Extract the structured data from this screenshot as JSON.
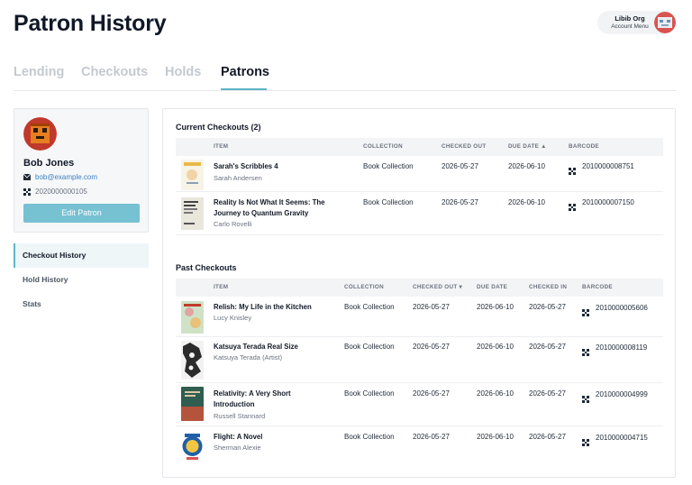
{
  "page_title": "Patron History",
  "account": {
    "org": "Libib Org",
    "menu_label": "Account Menu"
  },
  "tabs": [
    {
      "label": "Lending",
      "active": false
    },
    {
      "label": "Checkouts",
      "active": false
    },
    {
      "label": "Holds",
      "active": false
    },
    {
      "label": "Patrons",
      "active": true
    }
  ],
  "patron": {
    "name": "Bob Jones",
    "email": "bob@example.com",
    "card_number": "2020000000105",
    "edit_label": "Edit Patron"
  },
  "side_nav": [
    {
      "label": "Checkout History",
      "active": true
    },
    {
      "label": "Hold History",
      "active": false
    },
    {
      "label": "Stats",
      "active": false
    }
  ],
  "current_checkouts": {
    "title": "Current Checkouts (2)",
    "columns": [
      "ITEM",
      "COLLECTION",
      "CHECKED OUT",
      "DUE DATE ▲",
      "BARCODE"
    ],
    "rows": [
      {
        "title": "Sarah's Scribbles 4",
        "author": "Sarah Andersen",
        "collection": "Book Collection",
        "checked_out": "2026-05-27",
        "due_date": "2026-06-10",
        "barcode": "2010000008751",
        "cover": "scribbles-cover"
      },
      {
        "title": "Reality Is Not What It Seems: The Journey to Quantum Gravity",
        "author": "Carlo Rovelli",
        "collection": "Book Collection",
        "checked_out": "2026-05-27",
        "due_date": "2026-06-10",
        "barcode": "2010000007150",
        "cover": "reality-cover"
      }
    ]
  },
  "past_checkouts": {
    "title": "Past Checkouts",
    "columns": [
      "ITEM",
      "COLLECTION",
      "CHECKED OUT ▾",
      "DUE DATE",
      "CHECKED IN",
      "BARCODE"
    ],
    "rows": [
      {
        "title": "Relish: My Life in the Kitchen",
        "author": "Lucy Knisley",
        "collection": "Book Collection",
        "checked_out": "2026-05-27",
        "due_date": "2026-06-10",
        "checked_in": "2026-05-27",
        "barcode": "2010000005606",
        "cover": "relish-cover"
      },
      {
        "title": "Katsuya Terada Real Size",
        "author": "Katsuya Terada (Artist)",
        "collection": "Book Collection",
        "checked_out": "2026-05-27",
        "due_date": "2026-06-10",
        "checked_in": "2026-05-27",
        "barcode": "2010000008119",
        "cover": "terada-cover"
      },
      {
        "title": "Relativity: A Very Short Introduction",
        "author": "Russell Stannard",
        "collection": "Book Collection",
        "checked_out": "2026-05-27",
        "due_date": "2026-06-10",
        "checked_in": "2026-05-27",
        "barcode": "2010000004999",
        "cover": "relativity-cover"
      },
      {
        "title": "Flight: A Novel",
        "author": "Sherman Alexie",
        "collection": "Book Collection",
        "checked_out": "2026-05-27",
        "due_date": "2026-06-10",
        "checked_in": "2026-05-27",
        "barcode": "2010000004715",
        "cover": "flight-cover"
      }
    ]
  },
  "colors": {
    "accent": "#5fb4c6",
    "button": "#76c1d2",
    "link": "#3b82c4"
  },
  "icons": {
    "email": "envelope-icon",
    "card": "barcode-icon",
    "barcode": "barcode-icon"
  }
}
